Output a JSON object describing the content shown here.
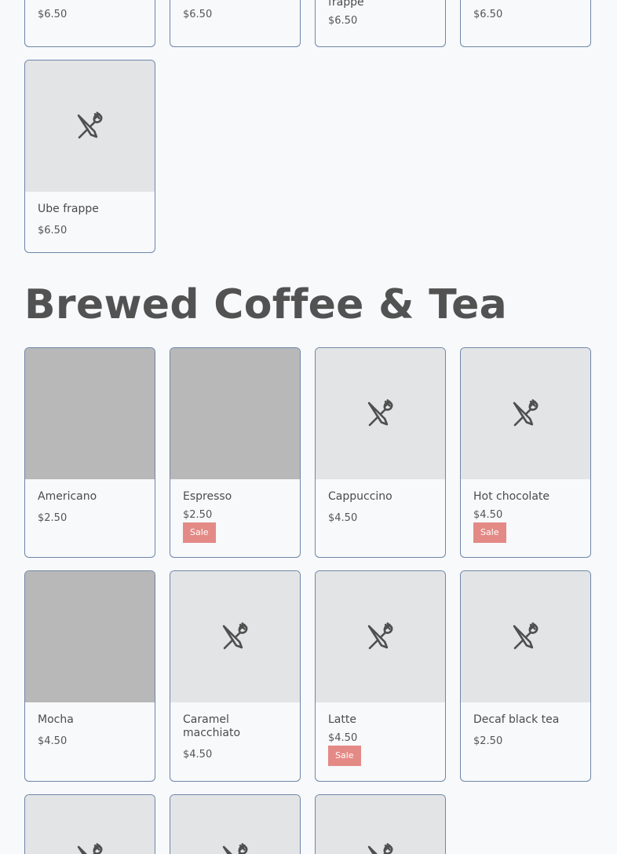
{
  "top_row": {
    "items": [
      {
        "name": "",
        "price": "$6.50"
      },
      {
        "name": "",
        "price": "$6.50"
      },
      {
        "name": "frappe",
        "price": "$6.50"
      },
      {
        "name": "",
        "price": "$6.50"
      }
    ]
  },
  "frappe_last": {
    "name": "Ube frappe",
    "price": "$6.50"
  },
  "section": {
    "title": "Brewed Coffee & Tea"
  },
  "items": [
    {
      "name": "Americano",
      "price": "$2.50"
    },
    {
      "name": "Espresso",
      "price": "$2.50",
      "badge": "Sale"
    },
    {
      "name": "Cappuccino",
      "price": "$4.50"
    },
    {
      "name": "Hot chocolate",
      "price": "$4.50",
      "badge": "Sale"
    },
    {
      "name": "Mocha",
      "price": "$4.50"
    },
    {
      "name": "Caramel macchiato",
      "price": "$4.50"
    },
    {
      "name": "Latte",
      "price": "$4.50",
      "badge": "Sale"
    },
    {
      "name": "Decaf black tea",
      "price": "$2.50"
    }
  ],
  "icon": "fork-knife-icon",
  "colors": {
    "border": "#6f86a8",
    "sale_badge": "#e48a86",
    "placeholder": "#e3e4e6",
    "photo": "#b8b8b8"
  }
}
